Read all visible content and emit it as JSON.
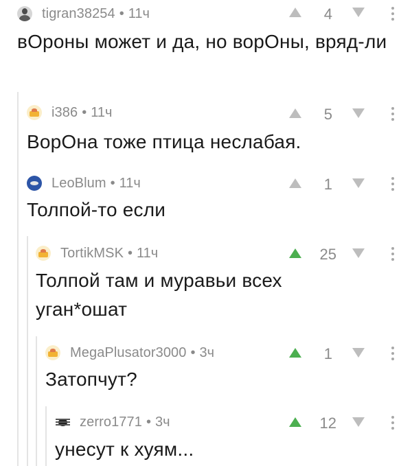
{
  "comments": [
    {
      "avatar": "person-avatar",
      "username": "tigran38254",
      "separator": "•",
      "time": "11ч",
      "rating": "4",
      "upvoted": false,
      "text": "вОроны может и да, но ворОны, вряд-ли"
    },
    {
      "avatar": "cake-avatar",
      "username": "i386",
      "separator": "•",
      "time": "11ч",
      "rating": "5",
      "upvoted": false,
      "text": "ВорОна тоже птица неслабая."
    },
    {
      "avatar": "eye-avatar",
      "username": "LeoBlum",
      "separator": "•",
      "time": "11ч",
      "rating": "1",
      "upvoted": false,
      "text": "Толпой-то если"
    },
    {
      "avatar": "cake-avatar",
      "username": "TortikMSK",
      "separator": "•",
      "time": "11ч",
      "rating": "25",
      "upvoted": true,
      "text": "Толпой там и муравьи всех уган*ошат"
    },
    {
      "avatar": "cake-avatar",
      "username": "MegaPlusator3000",
      "separator": "•",
      "time": "3ч",
      "rating": "1",
      "upvoted": true,
      "text": "Затопчут?"
    },
    {
      "avatar": "bug-avatar",
      "username": "zerro1771",
      "separator": "•",
      "time": "3ч",
      "rating": "12",
      "upvoted": true,
      "text": "унесут к хуям..."
    }
  ],
  "colors": {
    "upvote_active": "#4caf50",
    "vote_inactive": "#bdbdbd",
    "meta_text": "#8a8a8a",
    "thread_line": "#e4e4e4"
  }
}
